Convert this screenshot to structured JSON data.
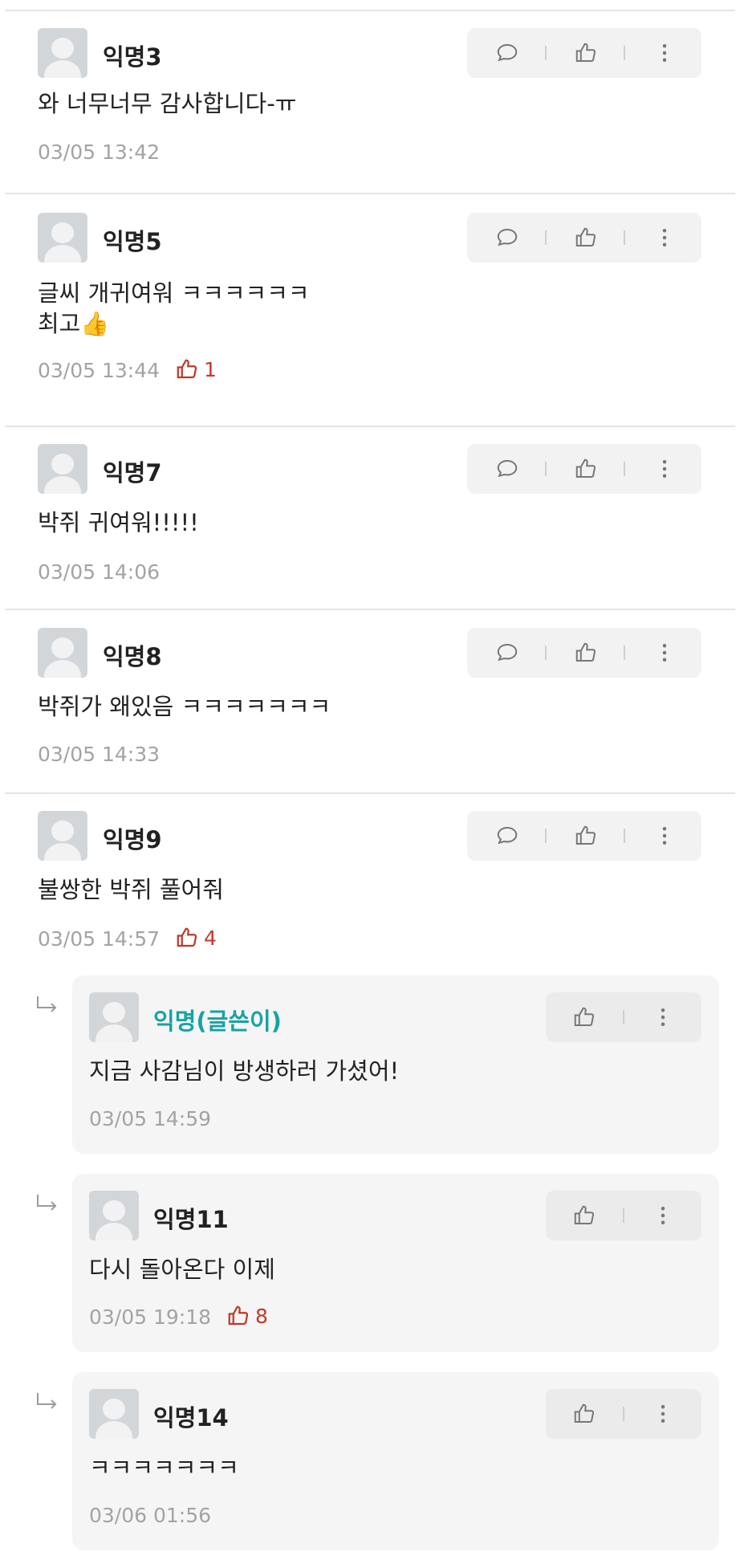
{
  "colors": {
    "accent_op": "#17a3a3",
    "like_active": "#c0392b",
    "meta_gray": "#a3a3a3"
  },
  "icons": {
    "reply": "speech-bubble-icon",
    "like": "thumbs-up-icon",
    "more": "vertical-dots-icon",
    "reply_indent": "reply-arrow-icon"
  },
  "comments": [
    {
      "author": "익명3",
      "text": "와 너무너무 감사합니다-ㅠ",
      "date": "03/05 13:42"
    },
    {
      "author": "익명5",
      "text_line1": "글씨 개귀여워 ㅋㅋㅋㅋㅋㅋ",
      "text_line2": "최고",
      "emoji": "👍",
      "date": "03/05 13:44",
      "likes": "1"
    },
    {
      "author": "익명7",
      "text": "박쥐 귀여워!!!!!",
      "date": "03/05 14:06"
    },
    {
      "author": "익명8",
      "text": "박쥐가 왜있음 ㅋㅋㅋㅋㅋㅋㅋ",
      "date": "03/05 14:33"
    },
    {
      "author": "익명9",
      "text": "불쌍한 박쥐 풀어줘",
      "date": "03/05 14:57",
      "likes": "4"
    }
  ],
  "replies": [
    {
      "author": "익명(글쓴이)",
      "text": "지금 사감님이 방생하러 가셨어!",
      "date": "03/05 14:59"
    },
    {
      "author": "익명11",
      "text": "다시 돌아온다 이제",
      "date": "03/05 19:18",
      "likes": "8"
    },
    {
      "author": "익명14",
      "text": "ㅋㅋㅋㅋㅋㅋㅋ",
      "date": "03/06 01:56"
    }
  ]
}
